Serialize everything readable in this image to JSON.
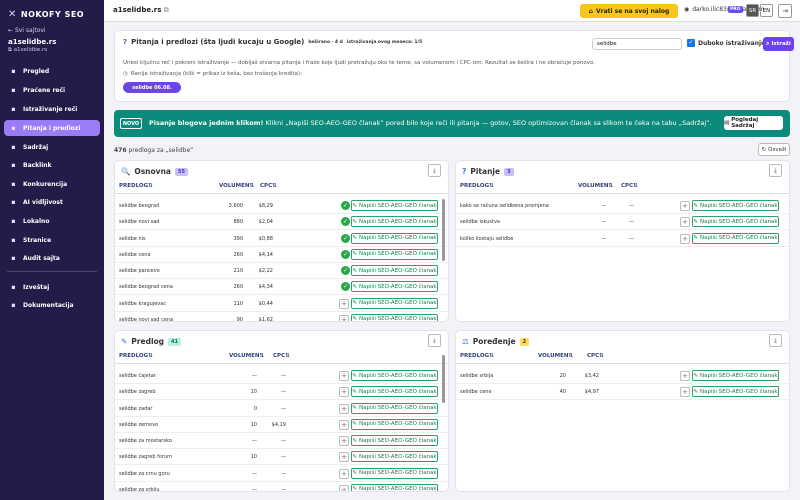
{
  "app": {
    "brand": "NOKOFY SEO",
    "back": "Svi sajtovi",
    "site_name": "a1selidbe.rs",
    "site_url": "a1selidbe.rs"
  },
  "nav": [
    {
      "label": "Pregled",
      "icon": "grid-icon"
    },
    {
      "label": "Praćene reči",
      "icon": "pin-icon"
    },
    {
      "label": "Istraživanje reči",
      "icon": "search-icon"
    },
    {
      "label": "Pitanja i predlozi",
      "icon": "question-icon",
      "active": true
    },
    {
      "label": "Sadržaj",
      "icon": "pencil-icon"
    },
    {
      "label": "Backlink",
      "icon": "link-icon"
    },
    {
      "label": "Konkurencija",
      "icon": "bar-chart-icon"
    },
    {
      "label": "AI vidljivost",
      "icon": "robot-icon"
    },
    {
      "label": "Lokalno",
      "icon": "map-pin-icon"
    },
    {
      "label": "Stranice",
      "icon": "page-icon"
    },
    {
      "label": "Audit sajta",
      "icon": "shield-icon"
    }
  ],
  "nav_bottom": [
    {
      "label": "Izveštaj",
      "icon": "report-icon"
    },
    {
      "label": "Dokumentacija",
      "icon": "book-icon"
    }
  ],
  "topbar": {
    "domain": "a1selidbe.rs",
    "return": "Vrati se na svoj nalog",
    "user": "darko.ilic83@gmail.com",
    "plan": "PRO",
    "lang_sr": "SR",
    "lang_en": "EN"
  },
  "panel": {
    "title": "Pitanja i predlozi (šta ljudi kucaju u Google)",
    "cached": "keširano · 4 d",
    "monthly": "istraživanja ovog meseca: 1/5",
    "query": "selidbe",
    "deep": "Duboko istraživanje",
    "search": "Istraži",
    "hint": "Unesi ključnu reč i pokreni istraživanje — dobijaš stvarna pitanja i fraze koje ljudi pretražuju oko te teme, sa volumenom i CPC-om. Rezultat se kešira i ne obračuje ponovo.",
    "hint2": "Ranija istraživanja (klik = prikaz iz keša, bez trošenja kredita):",
    "history": "selidbe 06.08."
  },
  "banner": {
    "tag": "NOVO",
    "strong": "Pisanje blogova jednim klikom!",
    "text": "Klikni „Napiši SEO-AEO-GEO članak” pored bilo koje reči ili pitanja — gotov, SEO optimizovan članak sa slikom te čeka na tabu „Sadržaj”.",
    "button": "Pogledaj Sadržaj"
  },
  "summary": {
    "count": "476",
    "text": "predloga za „selidbe”",
    "refresh": "Osveži"
  },
  "labels": {
    "col_keyword": "PREDLOG",
    "col_volume": "VOLUMEN",
    "col_cpc": "CPC",
    "write": "Napiši SEO-AEO-GEO članak",
    "sort": "⇅"
  },
  "sections": {
    "osnovna": {
      "title": "Osnovna",
      "count": "55",
      "rows": [
        {
          "kw": "selidbe beograd",
          "vol": "3.600",
          "cpc": "$8,29",
          "done": true
        },
        {
          "kw": "selidbe novi sad",
          "vol": "880",
          "cpc": "$2,04",
          "done": true
        },
        {
          "kw": "selidbe nis",
          "vol": "390",
          "cpc": "$0,88",
          "done": true
        },
        {
          "kw": "selidbe cena",
          "vol": "260",
          "cpc": "$4,14",
          "done": true
        },
        {
          "kw": "selidbe pancevo",
          "vol": "210",
          "cpc": "$2,22",
          "done": true
        },
        {
          "kw": "selidbe beograd cena",
          "vol": "260",
          "cpc": "$4,34",
          "done": true
        },
        {
          "kw": "selidbe kragujevac",
          "vol": "110",
          "cpc": "$0,44",
          "done": false
        },
        {
          "kw": "selidbe novi sad cena",
          "vol": "90",
          "cpc": "$1,62",
          "done": false
        }
      ]
    },
    "pitanje": {
      "title": "Pitanje",
      "count": "3",
      "rows": [
        {
          "kw": "kako se računa selidbena promjena",
          "vol": "—",
          "cpc": "—"
        },
        {
          "kw": "selidbe iskustva",
          "vol": "—",
          "cpc": "—"
        },
        {
          "kw": "koliko kostaju selidbe",
          "vol": "—",
          "cpc": "—"
        }
      ]
    },
    "predlog": {
      "title": "Predlog",
      "count": "41",
      "rows": [
        {
          "kw": "selidbe čajetar",
          "vol": "—",
          "cpc": "—"
        },
        {
          "kw": "selidbe zagreb",
          "vol": "10",
          "cpc": "—"
        },
        {
          "kw": "selidbe zadar",
          "vol": "0",
          "cpc": "—"
        },
        {
          "kw": "selidbe zemovo",
          "vol": "10",
          "cpc": "$4,19"
        },
        {
          "kw": "selidbe za mostarsko",
          "vol": "—",
          "cpc": "—"
        },
        {
          "kw": "selidbe zagreb forum",
          "vol": "10",
          "cpc": "—"
        },
        {
          "kw": "selidbe za crnu goru",
          "vol": "—",
          "cpc": "—"
        },
        {
          "kw": "selidbe za srbiju",
          "vol": "—",
          "cpc": "—"
        }
      ]
    },
    "poredjenje": {
      "title": "Poređenje",
      "count": "2",
      "rows": [
        {
          "kw": "selidbe srbija",
          "vol": "20",
          "cpc": "$3,42"
        },
        {
          "kw": "selidbe cene",
          "vol": "40",
          "cpc": "$4,97"
        }
      ]
    }
  }
}
